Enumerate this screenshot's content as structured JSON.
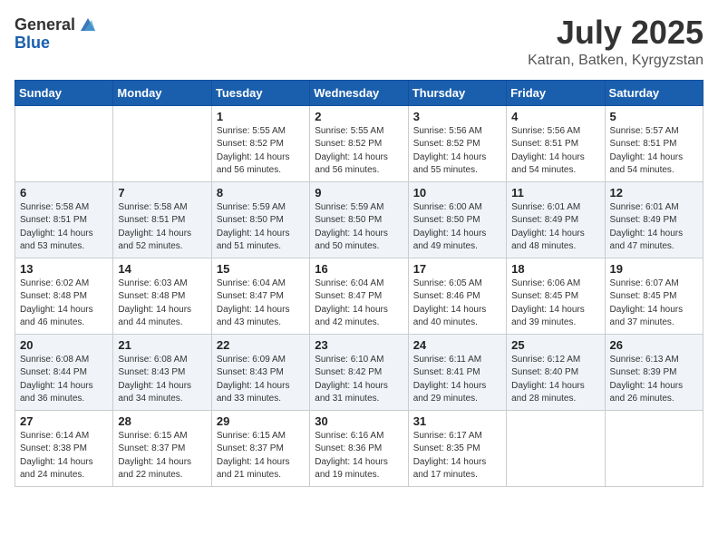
{
  "header": {
    "logo_general": "General",
    "logo_blue": "Blue",
    "month": "July 2025",
    "location": "Katran, Batken, Kyrgyzstan"
  },
  "days_of_week": [
    "Sunday",
    "Monday",
    "Tuesday",
    "Wednesday",
    "Thursday",
    "Friday",
    "Saturday"
  ],
  "weeks": [
    [
      {
        "day": "",
        "sunrise": "",
        "sunset": "",
        "daylight": ""
      },
      {
        "day": "",
        "sunrise": "",
        "sunset": "",
        "daylight": ""
      },
      {
        "day": "1",
        "sunrise": "Sunrise: 5:55 AM",
        "sunset": "Sunset: 8:52 PM",
        "daylight": "Daylight: 14 hours and 56 minutes."
      },
      {
        "day": "2",
        "sunrise": "Sunrise: 5:55 AM",
        "sunset": "Sunset: 8:52 PM",
        "daylight": "Daylight: 14 hours and 56 minutes."
      },
      {
        "day": "3",
        "sunrise": "Sunrise: 5:56 AM",
        "sunset": "Sunset: 8:52 PM",
        "daylight": "Daylight: 14 hours and 55 minutes."
      },
      {
        "day": "4",
        "sunrise": "Sunrise: 5:56 AM",
        "sunset": "Sunset: 8:51 PM",
        "daylight": "Daylight: 14 hours and 54 minutes."
      },
      {
        "day": "5",
        "sunrise": "Sunrise: 5:57 AM",
        "sunset": "Sunset: 8:51 PM",
        "daylight": "Daylight: 14 hours and 54 minutes."
      }
    ],
    [
      {
        "day": "6",
        "sunrise": "Sunrise: 5:58 AM",
        "sunset": "Sunset: 8:51 PM",
        "daylight": "Daylight: 14 hours and 53 minutes."
      },
      {
        "day": "7",
        "sunrise": "Sunrise: 5:58 AM",
        "sunset": "Sunset: 8:51 PM",
        "daylight": "Daylight: 14 hours and 52 minutes."
      },
      {
        "day": "8",
        "sunrise": "Sunrise: 5:59 AM",
        "sunset": "Sunset: 8:50 PM",
        "daylight": "Daylight: 14 hours and 51 minutes."
      },
      {
        "day": "9",
        "sunrise": "Sunrise: 5:59 AM",
        "sunset": "Sunset: 8:50 PM",
        "daylight": "Daylight: 14 hours and 50 minutes."
      },
      {
        "day": "10",
        "sunrise": "Sunrise: 6:00 AM",
        "sunset": "Sunset: 8:50 PM",
        "daylight": "Daylight: 14 hours and 49 minutes."
      },
      {
        "day": "11",
        "sunrise": "Sunrise: 6:01 AM",
        "sunset": "Sunset: 8:49 PM",
        "daylight": "Daylight: 14 hours and 48 minutes."
      },
      {
        "day": "12",
        "sunrise": "Sunrise: 6:01 AM",
        "sunset": "Sunset: 8:49 PM",
        "daylight": "Daylight: 14 hours and 47 minutes."
      }
    ],
    [
      {
        "day": "13",
        "sunrise": "Sunrise: 6:02 AM",
        "sunset": "Sunset: 8:48 PM",
        "daylight": "Daylight: 14 hours and 46 minutes."
      },
      {
        "day": "14",
        "sunrise": "Sunrise: 6:03 AM",
        "sunset": "Sunset: 8:48 PM",
        "daylight": "Daylight: 14 hours and 44 minutes."
      },
      {
        "day": "15",
        "sunrise": "Sunrise: 6:04 AM",
        "sunset": "Sunset: 8:47 PM",
        "daylight": "Daylight: 14 hours and 43 minutes."
      },
      {
        "day": "16",
        "sunrise": "Sunrise: 6:04 AM",
        "sunset": "Sunset: 8:47 PM",
        "daylight": "Daylight: 14 hours and 42 minutes."
      },
      {
        "day": "17",
        "sunrise": "Sunrise: 6:05 AM",
        "sunset": "Sunset: 8:46 PM",
        "daylight": "Daylight: 14 hours and 40 minutes."
      },
      {
        "day": "18",
        "sunrise": "Sunrise: 6:06 AM",
        "sunset": "Sunset: 8:45 PM",
        "daylight": "Daylight: 14 hours and 39 minutes."
      },
      {
        "day": "19",
        "sunrise": "Sunrise: 6:07 AM",
        "sunset": "Sunset: 8:45 PM",
        "daylight": "Daylight: 14 hours and 37 minutes."
      }
    ],
    [
      {
        "day": "20",
        "sunrise": "Sunrise: 6:08 AM",
        "sunset": "Sunset: 8:44 PM",
        "daylight": "Daylight: 14 hours and 36 minutes."
      },
      {
        "day": "21",
        "sunrise": "Sunrise: 6:08 AM",
        "sunset": "Sunset: 8:43 PM",
        "daylight": "Daylight: 14 hours and 34 minutes."
      },
      {
        "day": "22",
        "sunrise": "Sunrise: 6:09 AM",
        "sunset": "Sunset: 8:43 PM",
        "daylight": "Daylight: 14 hours and 33 minutes."
      },
      {
        "day": "23",
        "sunrise": "Sunrise: 6:10 AM",
        "sunset": "Sunset: 8:42 PM",
        "daylight": "Daylight: 14 hours and 31 minutes."
      },
      {
        "day": "24",
        "sunrise": "Sunrise: 6:11 AM",
        "sunset": "Sunset: 8:41 PM",
        "daylight": "Daylight: 14 hours and 29 minutes."
      },
      {
        "day": "25",
        "sunrise": "Sunrise: 6:12 AM",
        "sunset": "Sunset: 8:40 PM",
        "daylight": "Daylight: 14 hours and 28 minutes."
      },
      {
        "day": "26",
        "sunrise": "Sunrise: 6:13 AM",
        "sunset": "Sunset: 8:39 PM",
        "daylight": "Daylight: 14 hours and 26 minutes."
      }
    ],
    [
      {
        "day": "27",
        "sunrise": "Sunrise: 6:14 AM",
        "sunset": "Sunset: 8:38 PM",
        "daylight": "Daylight: 14 hours and 24 minutes."
      },
      {
        "day": "28",
        "sunrise": "Sunrise: 6:15 AM",
        "sunset": "Sunset: 8:37 PM",
        "daylight": "Daylight: 14 hours and 22 minutes."
      },
      {
        "day": "29",
        "sunrise": "Sunrise: 6:15 AM",
        "sunset": "Sunset: 8:37 PM",
        "daylight": "Daylight: 14 hours and 21 minutes."
      },
      {
        "day": "30",
        "sunrise": "Sunrise: 6:16 AM",
        "sunset": "Sunset: 8:36 PM",
        "daylight": "Daylight: 14 hours and 19 minutes."
      },
      {
        "day": "31",
        "sunrise": "Sunrise: 6:17 AM",
        "sunset": "Sunset: 8:35 PM",
        "daylight": "Daylight: 14 hours and 17 minutes."
      },
      {
        "day": "",
        "sunrise": "",
        "sunset": "",
        "daylight": ""
      },
      {
        "day": "",
        "sunrise": "",
        "sunset": "",
        "daylight": ""
      }
    ]
  ]
}
